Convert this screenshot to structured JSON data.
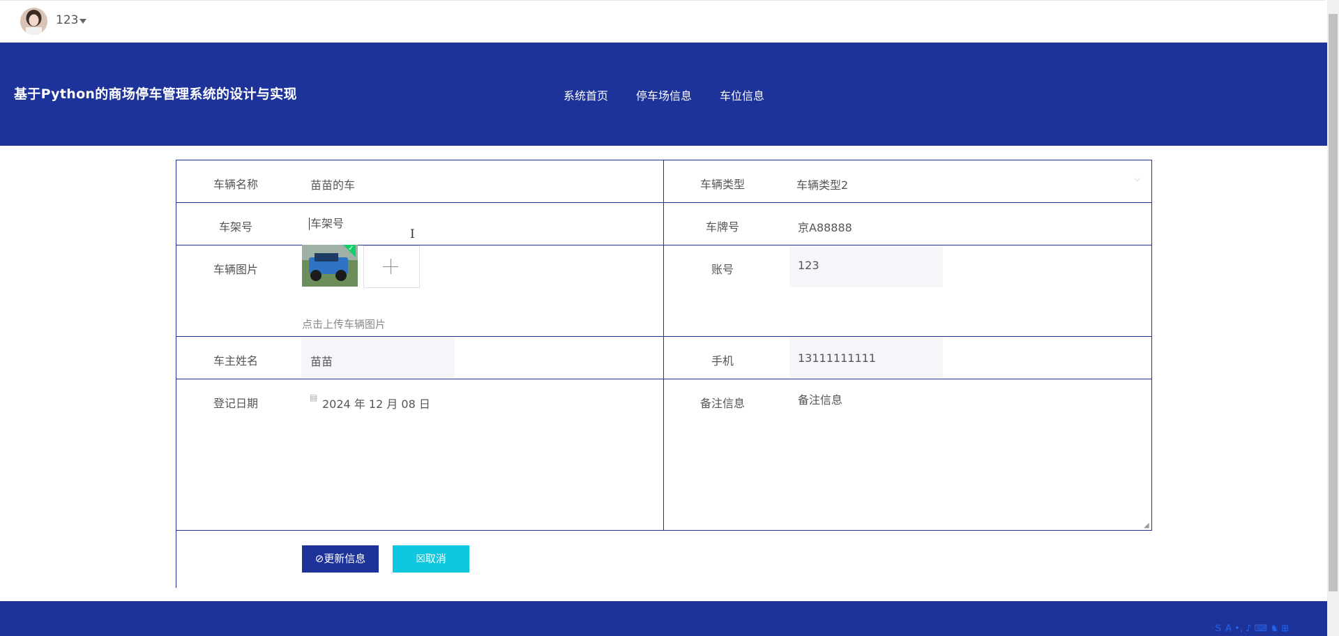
{
  "user": {
    "name": "123"
  },
  "header": {
    "title": "基于Python的商场停车管理系统的设计与实现",
    "nav": [
      "系统首页",
      "停车场信息",
      "车位信息"
    ]
  },
  "form": {
    "vehicle_name_label": "车辆名称",
    "vehicle_name_value": "苗苗的车",
    "vehicle_type_label": "车辆类型",
    "vehicle_type_value": "车辆类型2",
    "frame_no_label": "车架号",
    "frame_no_placeholder": "车架号",
    "plate_label": "车牌号",
    "plate_value": "京A88888",
    "image_label": "车辆图片",
    "image_hint": "点击上传车辆图片",
    "account_label": "账号",
    "account_value": "123",
    "owner_label": "车主姓名",
    "owner_value": "苗苗",
    "phone_label": "手机",
    "phone_value": "13111111111",
    "date_label": "登记日期",
    "date_value": "2024 年 12 月 08 日",
    "remark_label": "备注信息",
    "remark_placeholder": "备注信息"
  },
  "buttons": {
    "update": "⊘更新信息",
    "cancel": "☒取消"
  },
  "colors": {
    "primary": "#1e3399",
    "cancel": "#10c7e0",
    "success": "#13ce66"
  }
}
